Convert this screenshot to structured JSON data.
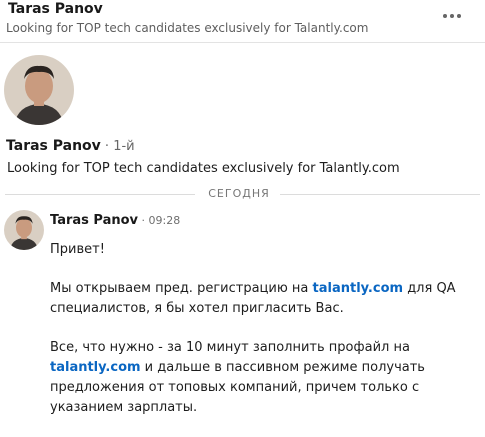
{
  "header": {
    "name": "Taras Panov",
    "subtitle": "Looking for TOP tech candidates exclusively for Talantly.com"
  },
  "profile": {
    "name": "Taras Panov",
    "degree": " · 1-й",
    "headline": "Looking for TOP tech candidates exclusively for Talantly.com"
  },
  "divider": {
    "label": "СЕГОДНЯ"
  },
  "message": {
    "sender": "Taras Panov",
    "time": " · 09:28",
    "greeting": "Привет!",
    "p1_before": "Мы открываем пред. регистрацию на ",
    "p1_link": "talantly.com",
    "p1_after": " для QA специалистов, я бы хотел пригласить Вас.",
    "p2_before": "Все, что нужно - за 10 минут заполнить профайл на ",
    "p2_link": "talantly.com",
    "p2_after": " и дальше в пассивном режиме получать предложения от топовых компаний, причем только с указанием зарплаты."
  },
  "icons": {
    "more": "more-horizontal-icon",
    "avatar": "person-avatar"
  },
  "colors": {
    "link": "#0a66c2",
    "muted": "#666666"
  }
}
